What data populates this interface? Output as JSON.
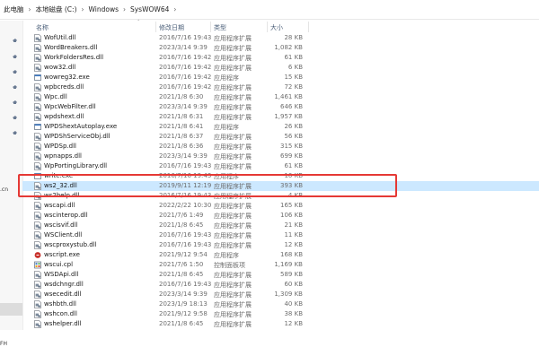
{
  "breadcrumb": [
    "此电脑",
    "本地磁盘 (C:)",
    "Windows",
    "SysWOW64"
  ],
  "nav": {
    "text_cn": ".cn",
    "text_fh": "FH"
  },
  "columns": {
    "name": "名称",
    "date": "修改日期",
    "type": "类型",
    "size": "大小"
  },
  "colors": {
    "selection": "#cce8ff",
    "highlight_box": "#e53935",
    "header_text": "#4c607a"
  },
  "files": [
    {
      "name": "WofUtil.dll",
      "date": "2016/7/16 19:43",
      "type": "应用程序扩展",
      "size": "28 KB",
      "icon": "dll-icon"
    },
    {
      "name": "WordBreakers.dll",
      "date": "2023/3/14 9:39",
      "type": "应用程序扩展",
      "size": "1,082 KB",
      "icon": "dll-icon"
    },
    {
      "name": "WorkFoldersRes.dll",
      "date": "2016/7/16 19:42",
      "type": "应用程序扩展",
      "size": "61 KB",
      "icon": "dll-icon"
    },
    {
      "name": "wow32.dll",
      "date": "2016/7/16 19:42",
      "type": "应用程序扩展",
      "size": "6 KB",
      "icon": "dll-icon"
    },
    {
      "name": "wowreg32.exe",
      "date": "2016/7/16 19:42",
      "type": "应用程序",
      "size": "15 KB",
      "icon": "exe-icon"
    },
    {
      "name": "wpbcreds.dll",
      "date": "2016/7/16 19:42",
      "type": "应用程序扩展",
      "size": "72 KB",
      "icon": "dll-icon"
    },
    {
      "name": "Wpc.dll",
      "date": "2021/1/8 6:30",
      "type": "应用程序扩展",
      "size": "1,461 KB",
      "icon": "dll-icon"
    },
    {
      "name": "WpcWebFilter.dll",
      "date": "2023/3/14 9:39",
      "type": "应用程序扩展",
      "size": "646 KB",
      "icon": "dll-icon"
    },
    {
      "name": "wpdshext.dll",
      "date": "2021/1/8 6:31",
      "type": "应用程序扩展",
      "size": "1,957 KB",
      "icon": "dll-icon"
    },
    {
      "name": "WPDShextAutoplay.exe",
      "date": "2021/1/8 6:41",
      "type": "应用程序",
      "size": "26 KB",
      "icon": "exe-icon"
    },
    {
      "name": "WPDShServiceObj.dll",
      "date": "2021/1/8 6:37",
      "type": "应用程序扩展",
      "size": "56 KB",
      "icon": "dll-icon"
    },
    {
      "name": "WPDSp.dll",
      "date": "2021/1/8 6:36",
      "type": "应用程序扩展",
      "size": "315 KB",
      "icon": "dll-icon"
    },
    {
      "name": "wpnapps.dll",
      "date": "2023/3/14 9:39",
      "type": "应用程序扩展",
      "size": "699 KB",
      "icon": "dll-icon"
    },
    {
      "name": "WpPortingLibrary.dll",
      "date": "2016/7/16 19:43",
      "type": "应用程序扩展",
      "size": "61 KB",
      "icon": "dll-icon"
    },
    {
      "name": "write.exe",
      "date": "2016/7/16 19:43",
      "type": "应用程序",
      "size": "10 KB",
      "icon": "exe-icon"
    },
    {
      "name": "ws2_32.dll",
      "date": "2019/9/11 12:19",
      "type": "应用程序扩展",
      "size": "393 KB",
      "icon": "dll-icon",
      "selected": true
    },
    {
      "name": "ws2help.dll",
      "date": "2016/7/16 19:43",
      "type": "应用程序扩展",
      "size": "4 KB",
      "icon": "dll-icon"
    },
    {
      "name": "wscapi.dll",
      "date": "2022/2/22 10:30",
      "type": "应用程序扩展",
      "size": "165 KB",
      "icon": "dll-icon"
    },
    {
      "name": "wscinterop.dll",
      "date": "2021/7/6 1:49",
      "type": "应用程序扩展",
      "size": "106 KB",
      "icon": "dll-icon"
    },
    {
      "name": "wscisvif.dll",
      "date": "2021/1/8 6:45",
      "type": "应用程序扩展",
      "size": "21 KB",
      "icon": "dll-icon"
    },
    {
      "name": "WSClient.dll",
      "date": "2016/7/16 19:43",
      "type": "应用程序扩展",
      "size": "11 KB",
      "icon": "dll-icon"
    },
    {
      "name": "wscproxystub.dll",
      "date": "2016/7/16 19:43",
      "type": "应用程序扩展",
      "size": "12 KB",
      "icon": "dll-icon"
    },
    {
      "name": "wscript.exe",
      "date": "2021/9/12 9:54",
      "type": "应用程序",
      "size": "168 KB",
      "icon": "wscript-icon"
    },
    {
      "name": "wscui.cpl",
      "date": "2021/7/6 1:50",
      "type": "控制面板项",
      "size": "1,169 KB",
      "icon": "cpl-icon"
    },
    {
      "name": "WSDApi.dll",
      "date": "2021/1/8 6:45",
      "type": "应用程序扩展",
      "size": "589 KB",
      "icon": "dll-icon"
    },
    {
      "name": "wsdchngr.dll",
      "date": "2016/7/16 19:43",
      "type": "应用程序扩展",
      "size": "60 KB",
      "icon": "dll-icon"
    },
    {
      "name": "wsecedit.dll",
      "date": "2023/3/14 9:39",
      "type": "应用程序扩展",
      "size": "1,309 KB",
      "icon": "dll-icon"
    },
    {
      "name": "wshbth.dll",
      "date": "2023/1/9 18:13",
      "type": "应用程序扩展",
      "size": "40 KB",
      "icon": "dll-icon"
    },
    {
      "name": "wshcon.dll",
      "date": "2021/9/12 9:58",
      "type": "应用程序扩展",
      "size": "38 KB",
      "icon": "dll-icon"
    },
    {
      "name": "wshelper.dll",
      "date": "2021/1/8 6:45",
      "type": "应用程序扩展",
      "size": "12 KB",
      "icon": "dll-icon"
    }
  ]
}
